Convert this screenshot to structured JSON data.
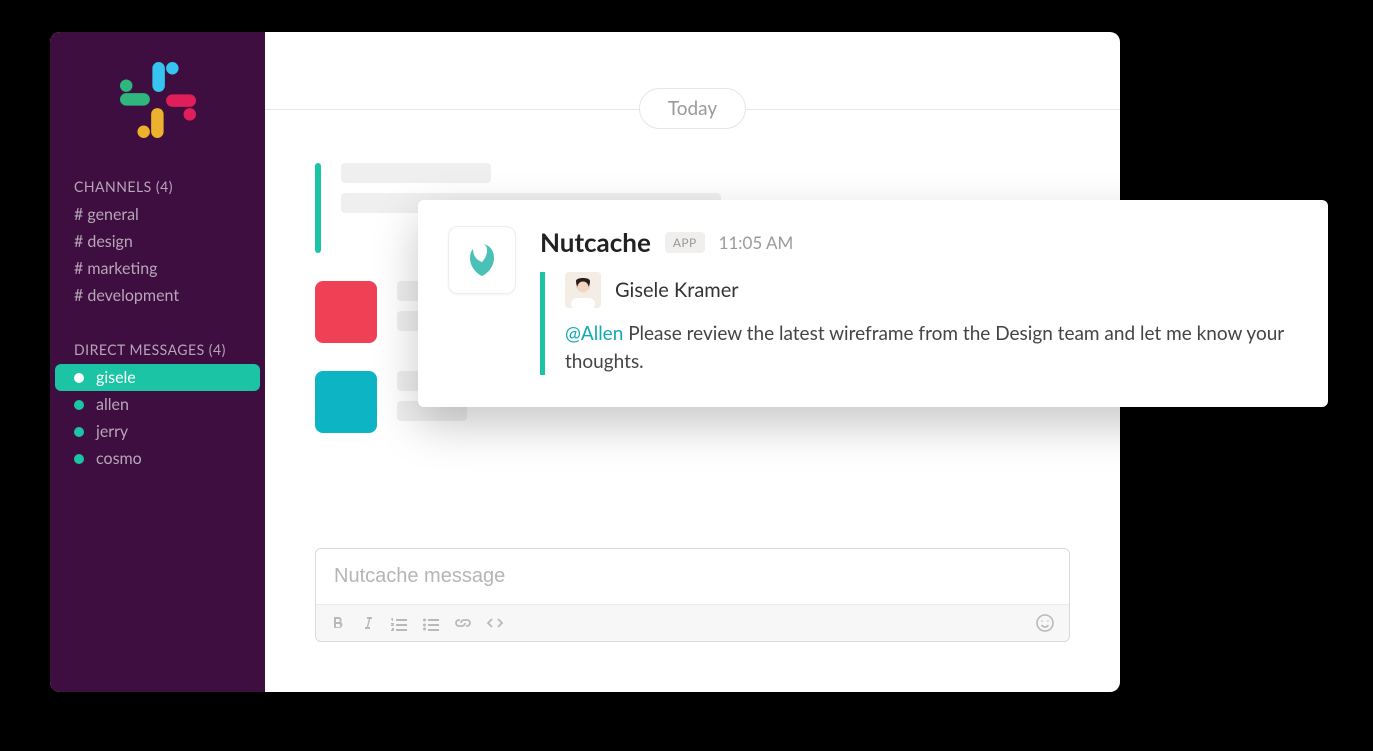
{
  "sidebar": {
    "channels_header": "CHANNELS (4)",
    "channels": [
      {
        "label": "# general"
      },
      {
        "label": "# design"
      },
      {
        "label": "# marketing"
      },
      {
        "label": "# development"
      }
    ],
    "dm_header": "DIRECT MESSAGES (4)",
    "dms": [
      {
        "label": "gisele",
        "active": true
      },
      {
        "label": "allen",
        "active": false
      },
      {
        "label": "jerry",
        "active": false
      },
      {
        "label": "cosmo",
        "active": false
      }
    ]
  },
  "date_label": "Today",
  "composer": {
    "placeholder": "Nutcache message"
  },
  "popup": {
    "app_name": "Nutcache",
    "badge": "APP",
    "time": "11:05 AM",
    "author": "Gisele Kramer",
    "mention": "@Allen",
    "message_rest": " Please review the latest wireframe from the Design team and let me know your thoughts."
  }
}
